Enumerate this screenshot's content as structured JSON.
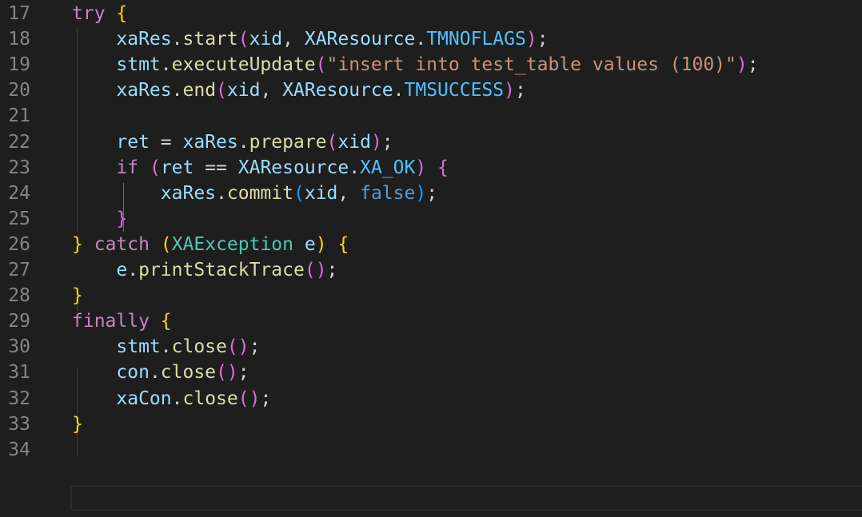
{
  "editor": {
    "theme_colors": {
      "background": "#1e1e1e",
      "line_number": "#858585",
      "keyword": "#c586c0",
      "variable": "#9cdcfe",
      "function": "#dcdcaa",
      "type": "#4ec9b0",
      "constant": "#4fc1ff",
      "string": "#ce9178",
      "boolean": "#569cd6",
      "punctuation": "#d4d4d4",
      "bracket_level_1": "#ffd700",
      "bracket_level_2": "#da70d6",
      "bracket_level_3": "#179fff"
    },
    "lines": [
      {
        "number": "17",
        "tokens": [
          {
            "t": "try",
            "c": "kw"
          },
          {
            "t": " ",
            "c": "pun"
          },
          {
            "t": "{",
            "c": "br1"
          }
        ]
      },
      {
        "number": "18",
        "tokens": [
          {
            "t": "    ",
            "c": "pun"
          },
          {
            "t": "xaRes",
            "c": "var"
          },
          {
            "t": ".",
            "c": "pun"
          },
          {
            "t": "start",
            "c": "fn"
          },
          {
            "t": "(",
            "c": "br2"
          },
          {
            "t": "xid",
            "c": "var"
          },
          {
            "t": ", ",
            "c": "pun"
          },
          {
            "t": "XAResource",
            "c": "var"
          },
          {
            "t": ".",
            "c": "pun"
          },
          {
            "t": "TMNOFLAGS",
            "c": "cst"
          },
          {
            "t": ")",
            "c": "br2"
          },
          {
            "t": ";",
            "c": "pun"
          }
        ]
      },
      {
        "number": "19",
        "tokens": [
          {
            "t": "    ",
            "c": "pun"
          },
          {
            "t": "stmt",
            "c": "var"
          },
          {
            "t": ".",
            "c": "pun"
          },
          {
            "t": "executeUpdate",
            "c": "fn"
          },
          {
            "t": "(",
            "c": "br2"
          },
          {
            "t": "\"insert into test_table values (100)\"",
            "c": "str"
          },
          {
            "t": ")",
            "c": "br2"
          },
          {
            "t": ";",
            "c": "pun"
          }
        ]
      },
      {
        "number": "20",
        "tokens": [
          {
            "t": "    ",
            "c": "pun"
          },
          {
            "t": "xaRes",
            "c": "var"
          },
          {
            "t": ".",
            "c": "pun"
          },
          {
            "t": "end",
            "c": "fn"
          },
          {
            "t": "(",
            "c": "br2"
          },
          {
            "t": "xid",
            "c": "var"
          },
          {
            "t": ", ",
            "c": "pun"
          },
          {
            "t": "XAResource",
            "c": "var"
          },
          {
            "t": ".",
            "c": "pun"
          },
          {
            "t": "TMSUCCESS",
            "c": "cst"
          },
          {
            "t": ")",
            "c": "br2"
          },
          {
            "t": ";",
            "c": "pun"
          }
        ]
      },
      {
        "number": "21",
        "tokens": []
      },
      {
        "number": "22",
        "tokens": [
          {
            "t": "    ",
            "c": "pun"
          },
          {
            "t": "ret",
            "c": "var"
          },
          {
            "t": " = ",
            "c": "pun"
          },
          {
            "t": "xaRes",
            "c": "var"
          },
          {
            "t": ".",
            "c": "pun"
          },
          {
            "t": "prepare",
            "c": "fn"
          },
          {
            "t": "(",
            "c": "br2"
          },
          {
            "t": "xid",
            "c": "var"
          },
          {
            "t": ")",
            "c": "br2"
          },
          {
            "t": ";",
            "c": "pun"
          }
        ]
      },
      {
        "number": "23",
        "tokens": [
          {
            "t": "    ",
            "c": "pun"
          },
          {
            "t": "if",
            "c": "kw"
          },
          {
            "t": " ",
            "c": "pun"
          },
          {
            "t": "(",
            "c": "br2"
          },
          {
            "t": "ret",
            "c": "var"
          },
          {
            "t": " == ",
            "c": "pun"
          },
          {
            "t": "XAResource",
            "c": "var"
          },
          {
            "t": ".",
            "c": "pun"
          },
          {
            "t": "XA_OK",
            "c": "cst"
          },
          {
            "t": ")",
            "c": "br2"
          },
          {
            "t": " ",
            "c": "pun"
          },
          {
            "t": "{",
            "c": "br2"
          }
        ]
      },
      {
        "number": "24",
        "tokens": [
          {
            "t": "        ",
            "c": "pun"
          },
          {
            "t": "xaRes",
            "c": "var"
          },
          {
            "t": ".",
            "c": "pun"
          },
          {
            "t": "commit",
            "c": "fn"
          },
          {
            "t": "(",
            "c": "br3"
          },
          {
            "t": "xid",
            "c": "var"
          },
          {
            "t": ", ",
            "c": "pun"
          },
          {
            "t": "false",
            "c": "bool"
          },
          {
            "t": ")",
            "c": "br3"
          },
          {
            "t": ";",
            "c": "pun"
          }
        ]
      },
      {
        "number": "25",
        "tokens": [
          {
            "t": "    ",
            "c": "pun"
          },
          {
            "t": "}",
            "c": "br2"
          }
        ]
      },
      {
        "number": "26",
        "tokens": [
          {
            "t": "}",
            "c": "br1"
          },
          {
            "t": " ",
            "c": "pun"
          },
          {
            "t": "catch",
            "c": "kw"
          },
          {
            "t": " ",
            "c": "pun"
          },
          {
            "t": "(",
            "c": "br1"
          },
          {
            "t": "XAException",
            "c": "ty"
          },
          {
            "t": " ",
            "c": "pun"
          },
          {
            "t": "e",
            "c": "var"
          },
          {
            "t": ")",
            "c": "br1"
          },
          {
            "t": " ",
            "c": "pun"
          },
          {
            "t": "{",
            "c": "br1"
          }
        ]
      },
      {
        "number": "27",
        "tokens": [
          {
            "t": "    ",
            "c": "pun"
          },
          {
            "t": "e",
            "c": "var"
          },
          {
            "t": ".",
            "c": "pun"
          },
          {
            "t": "printStackTrace",
            "c": "fn"
          },
          {
            "t": "(",
            "c": "br2"
          },
          {
            "t": ")",
            "c": "br2"
          },
          {
            "t": ";",
            "c": "pun"
          }
        ]
      },
      {
        "number": "28",
        "tokens": [
          {
            "t": "}",
            "c": "br1"
          }
        ]
      },
      {
        "number": "29",
        "tokens": [
          {
            "t": "finally",
            "c": "kw"
          },
          {
            "t": " ",
            "c": "pun"
          },
          {
            "t": "{",
            "c": "br1"
          }
        ]
      },
      {
        "number": "30",
        "tokens": [
          {
            "t": "    ",
            "c": "pun"
          },
          {
            "t": "stmt",
            "c": "var"
          },
          {
            "t": ".",
            "c": "pun"
          },
          {
            "t": "close",
            "c": "fn"
          },
          {
            "t": "(",
            "c": "br2"
          },
          {
            "t": ")",
            "c": "br2"
          },
          {
            "t": ";",
            "c": "pun"
          }
        ]
      },
      {
        "number": "31",
        "tokens": [
          {
            "t": "    ",
            "c": "pun"
          },
          {
            "t": "con",
            "c": "var"
          },
          {
            "t": ".",
            "c": "pun"
          },
          {
            "t": "close",
            "c": "fn"
          },
          {
            "t": "(",
            "c": "br2"
          },
          {
            "t": ")",
            "c": "br2"
          },
          {
            "t": ";",
            "c": "pun"
          }
        ]
      },
      {
        "number": "32",
        "tokens": [
          {
            "t": "    ",
            "c": "pun"
          },
          {
            "t": "xaCon",
            "c": "var"
          },
          {
            "t": ".",
            "c": "pun"
          },
          {
            "t": "close",
            "c": "fn"
          },
          {
            "t": "(",
            "c": "br2"
          },
          {
            "t": ")",
            "c": "br2"
          },
          {
            "t": ";",
            "c": "pun"
          }
        ]
      },
      {
        "number": "33",
        "tokens": [
          {
            "t": "}",
            "c": "br1"
          }
        ]
      },
      {
        "number": "34",
        "tokens": []
      }
    ]
  }
}
